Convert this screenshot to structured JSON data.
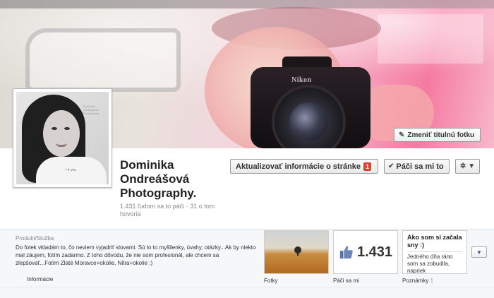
{
  "cover": {
    "camera_brand": "Nikon",
    "change_cover_label": "Zmeniť titulnú fotku",
    "change_cover_icon": "pencil-icon"
  },
  "profile": {
    "name": "Dominika Ondreášová Photography.",
    "stats": "1.431 ľudom sa to páči · 31 o tom hovoria",
    "photo_watermark": "Dominika Ondreasova Photography",
    "shirt_text": "I ♥ you"
  },
  "actions": {
    "update_label": "Aktualizovať informácie o stránke",
    "update_badge": "1",
    "like_label": "Páči sa mi to",
    "like_icon": "check-icon",
    "settings_icon": "gear-icon",
    "settings_caret": "▼"
  },
  "info": {
    "category": "Produkt/Služba",
    "about": "Do fotek vkladám to, čo neviem vyjadriť slovami. Sú to to myšlienky, úvahy, otázky...Ak by niekto mal záujem, fotím zadarmo. Z toho dôvodu, že nie som profesionál, ale chcem sa zlepšovať...Fotím Zlaté Moravce+okolie, Nitra+okolie :)",
    "info_link": "Informácie"
  },
  "apps": {
    "photos_label": "Fotky",
    "likes_count": "1.431",
    "likes_label": "Páči sa mi",
    "notes_title": "Ako som si začala sny :)",
    "notes_body": "Jedného dňa ráno som sa zobudila, napriek",
    "notes_label": "Poznámky",
    "notes_count": "1",
    "more_icon": "▼"
  },
  "colors": {
    "brand_blue": "#3b5998",
    "badge_red": "#e0402b"
  }
}
